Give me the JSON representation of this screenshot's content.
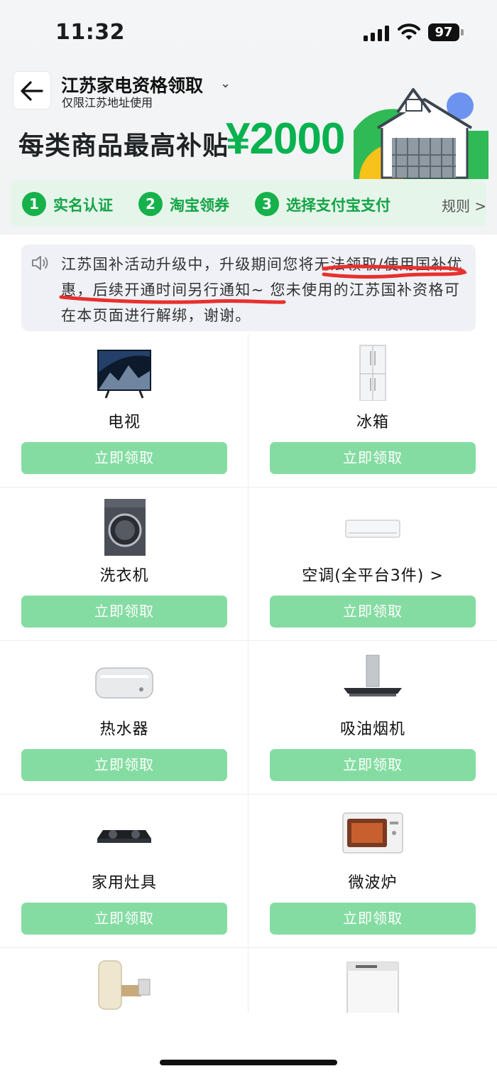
{
  "status_bar": {
    "time": "11:32",
    "battery": "97"
  },
  "header": {
    "title": "江苏家电资格领取",
    "subtitle": "仅限江苏地址使用",
    "slogan": "每类商品最高补贴",
    "amount": "¥2000"
  },
  "steps": [
    {
      "num": "1",
      "label": "实名认证"
    },
    {
      "num": "2",
      "label": "淘宝领券"
    },
    {
      "num": "3",
      "label": "选择支付宝支付"
    }
  ],
  "rules_label": "规则 >",
  "notice": {
    "text": "江苏国补活动升级中，升级期间您将无法领取/使用国补优惠，后续开通时间另行通知~ 您未使用的江苏国补资格可在本页面进行解绑，谢谢。"
  },
  "products": [
    {
      "name": "电视",
      "button": "立即领取",
      "icon": "tv-icon"
    },
    {
      "name": "冰箱",
      "button": "立即领取",
      "icon": "fridge-icon"
    },
    {
      "name": "洗衣机",
      "button": "立即领取",
      "icon": "washer-icon"
    },
    {
      "name": "空调(全平台3件) >",
      "button": "立即领取",
      "icon": "ac-icon"
    },
    {
      "name": "热水器",
      "button": "立即领取",
      "icon": "water-heater-icon"
    },
    {
      "name": "吸油烟机",
      "button": "立即领取",
      "icon": "range-hood-icon"
    },
    {
      "name": "家用灶具",
      "button": "立即领取",
      "icon": "stove-icon"
    },
    {
      "name": "微波炉",
      "button": "立即领取",
      "icon": "microwave-icon"
    },
    {
      "name": "",
      "button": "",
      "icon": "water-purifier-icon"
    },
    {
      "name": "",
      "button": "",
      "icon": "dishwasher-icon"
    }
  ],
  "colors": {
    "brand_green": "#16b14b",
    "button_green": "#85dca2",
    "step_bg": "#e6f5ea",
    "notice_bg": "#eff1f6",
    "scribble_red": "#e8302d"
  }
}
